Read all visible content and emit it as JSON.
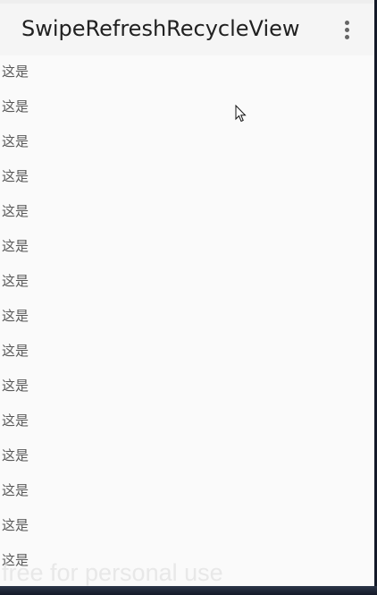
{
  "app_bar": {
    "title": "SwipeRefreshRecycleView",
    "overflow_icon": "more-vertical-icon"
  },
  "list": {
    "items": [
      {
        "label": "这是"
      },
      {
        "label": "这是"
      },
      {
        "label": "这是"
      },
      {
        "label": "这是"
      },
      {
        "label": "这是"
      },
      {
        "label": "这是"
      },
      {
        "label": "这是"
      },
      {
        "label": "这是"
      },
      {
        "label": "这是"
      },
      {
        "label": "这是"
      },
      {
        "label": "这是"
      },
      {
        "label": "这是"
      },
      {
        "label": "这是"
      },
      {
        "label": "这是"
      },
      {
        "label": "这是"
      }
    ]
  },
  "watermark": {
    "text": "free for personal use"
  },
  "colors": {
    "app_bar_background": "#f5f5f5",
    "content_background": "#fafafa",
    "title_text": "#212121",
    "item_text": "#595959"
  },
  "cursor_icon": "mouse-pointer-icon"
}
